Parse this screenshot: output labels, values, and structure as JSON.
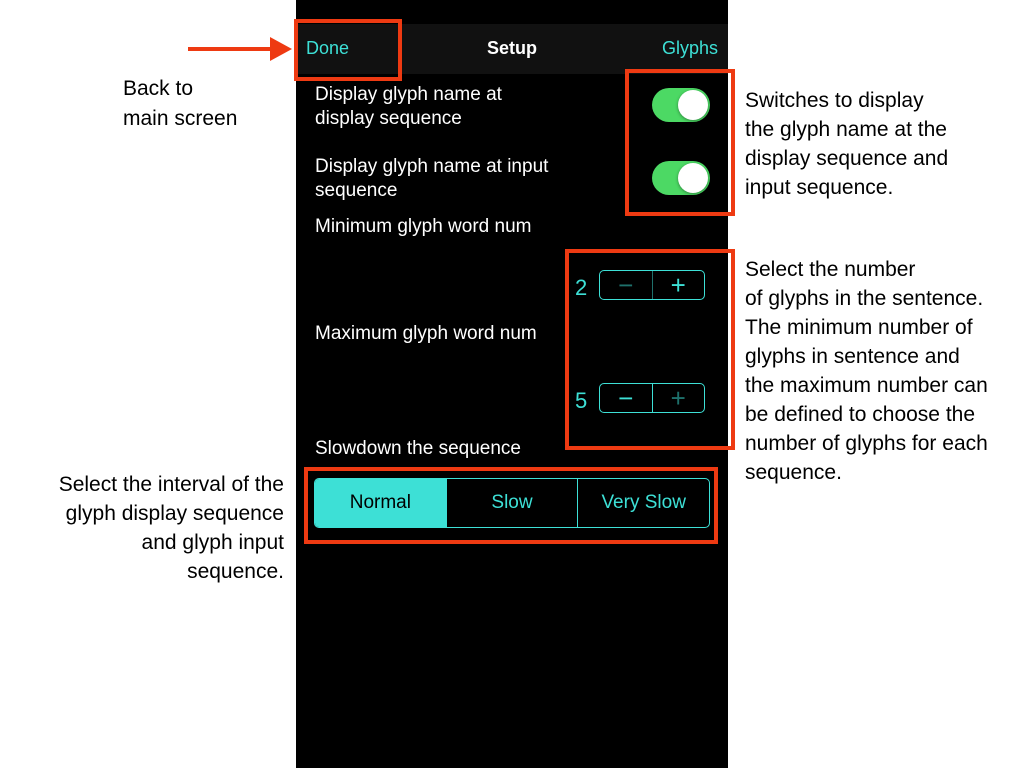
{
  "navbar": {
    "done": "Done",
    "title": "Setup",
    "glyphs": "Glyphs"
  },
  "settings": {
    "display_glyph_name": "Display glyph name at\ndisplay sequence",
    "input_glyph_name": "Display glyph name at input\nsequence",
    "min_word_num_label": "Minimum glyph word num",
    "max_word_num_label": "Maximum glyph word num",
    "min_value": "2",
    "max_value": "5",
    "slowdown_label": "Slowdown the sequence",
    "display_toggle_on": true,
    "input_toggle_on": true
  },
  "stepper": {
    "minus": "−",
    "plus": "+"
  },
  "speed": {
    "options": [
      "Normal",
      "Slow",
      "Very Slow"
    ],
    "selected": "Normal"
  },
  "annotations": {
    "back": "Back to\nmain screen",
    "switches": "Switches to display\nthe glyph name at the\ndisplay sequence and\ninput sequence.",
    "number": "Select the number\nof glyphs in the sentence.\nThe minimum number of\nglyphs in sentence and\nthe maximum number can\nbe defined to choose the\nnumber of glyphs for each\nsequence.",
    "interval": "Select the interval of the\nglyph display sequence\nand glyph input\nsequence."
  },
  "colors": {
    "accent": "#3de0d6",
    "switch_on": "#4cd964",
    "callout": "#ee3a12"
  }
}
